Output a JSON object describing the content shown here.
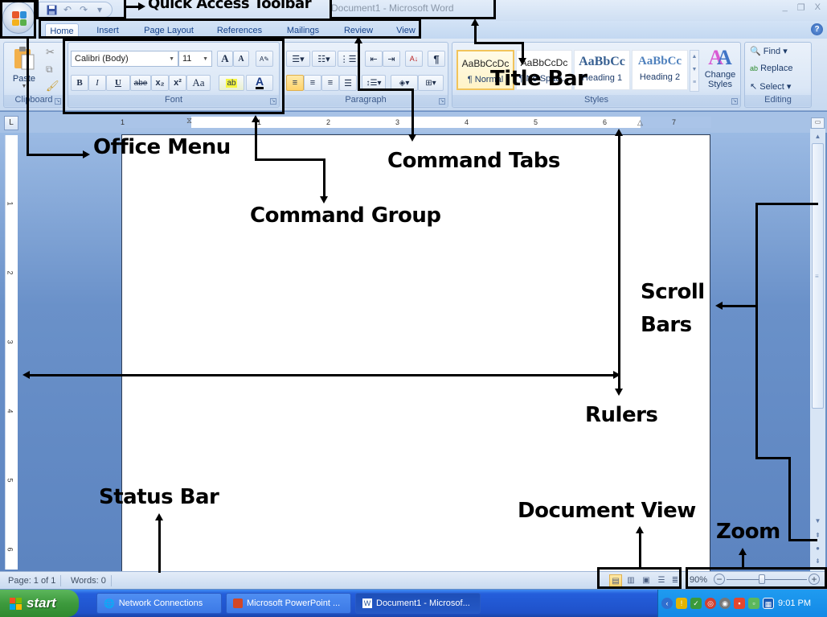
{
  "window": {
    "title": "Document1 - Microsoft Word",
    "controls": {
      "minimize": "_",
      "restore": "❐",
      "close": "X"
    },
    "help": "?"
  },
  "quick_access": {
    "save": "save-icon",
    "undo": "↶",
    "redo": "↷",
    "customize": "▾"
  },
  "tabs": [
    {
      "label": "Home",
      "active": true
    },
    {
      "label": "Insert"
    },
    {
      "label": "Page Layout"
    },
    {
      "label": "References"
    },
    {
      "label": "Mailings"
    },
    {
      "label": "Review"
    },
    {
      "label": "View"
    }
  ],
  "ribbon": {
    "clipboard": {
      "label": "Clipboard",
      "paste": "Paste"
    },
    "font": {
      "label": "Font",
      "font_name": "Calibri (Body)",
      "font_size": "11",
      "grow": "A",
      "shrink": "A",
      "bold": "B",
      "italic": "I",
      "underline": "U",
      "strike": "abe",
      "subscript": "x₂",
      "superscript": "x²",
      "change_case": "Aa",
      "highlight": "ab",
      "font_color": "A"
    },
    "paragraph": {
      "label": "Paragraph",
      "sort": "A↓",
      "pilcrow": "¶"
    },
    "styles": {
      "label": "Styles",
      "items": [
        {
          "sample": "AaBbCcDc",
          "name": "¶ Normal",
          "selected": true
        },
        {
          "sample": "AaBbCcDc",
          "name": "¶ No Spaci..."
        },
        {
          "sample": "AaBbCc",
          "name": "Heading 1"
        },
        {
          "sample": "AaBbCc",
          "name": "Heading 2"
        }
      ],
      "change_styles": "Change Styles"
    },
    "editing": {
      "label": "Editing",
      "find": "Find",
      "replace": "Replace",
      "select": "Select"
    }
  },
  "ruler": {
    "horizontal": [
      "1",
      "1",
      "2",
      "3",
      "4",
      "5",
      "6",
      "7"
    ],
    "vertical": [
      "1",
      "2",
      "3",
      "4",
      "5",
      "6"
    ],
    "tab_selector": "L"
  },
  "status": {
    "page": "Page: 1 of 1",
    "words": "Words: 0",
    "zoom": "90%",
    "zoom_level_percent": 90
  },
  "taskbar": {
    "start": "start",
    "tasks": [
      {
        "label": "Network Connections"
      },
      {
        "label": "Microsoft PowerPoint ..."
      },
      {
        "label": "Document1 - Microsof..."
      }
    ],
    "clock": "9:01 PM"
  },
  "annotations": {
    "quick_access_toolbar": "Quick Access Toolbar",
    "title_bar": "Title Bar",
    "office_menu": "Office Menu",
    "command_tabs": "Command Tabs",
    "command_group": "Command Group",
    "scroll_bars_1": "Scroll",
    "scroll_bars_2": "Bars",
    "rulers": "Rulers",
    "status_bar": "Status Bar",
    "document_view": "Document View",
    "zoom": "Zoom"
  }
}
